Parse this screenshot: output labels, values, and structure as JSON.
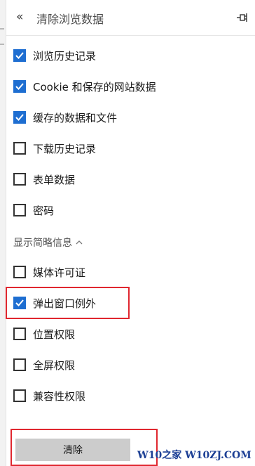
{
  "header": {
    "title": "清除浏览数据",
    "back_icon": "double-chevron-left-icon",
    "pin_icon": "pin-icon"
  },
  "items": [
    {
      "label": "浏览历史记录",
      "checked": true
    },
    {
      "label": "Cookie 和保存的网站数据",
      "checked": true
    },
    {
      "label": "缓存的数据和文件",
      "checked": true
    },
    {
      "label": "下载历史记录",
      "checked": false
    },
    {
      "label": "表单数据",
      "checked": false
    },
    {
      "label": "密码",
      "checked": false
    }
  ],
  "show_less": {
    "label": "显示简略信息",
    "icon": "chevron-up-icon"
  },
  "extra_items": [
    {
      "label": "媒体许可证",
      "checked": false
    },
    {
      "label": "弹出窗口例外",
      "checked": true
    },
    {
      "label": "位置权限",
      "checked": false
    },
    {
      "label": "全屏权限",
      "checked": false
    },
    {
      "label": "兼容性权限",
      "checked": false
    }
  ],
  "clear_button": {
    "label": "清除"
  },
  "watermark": "W10之家 W10ZJ.COM",
  "colors": {
    "accent": "#1e6ed1",
    "highlight": "#e0272f",
    "button_bg": "#cccccc",
    "watermark": "#1c3f95"
  }
}
